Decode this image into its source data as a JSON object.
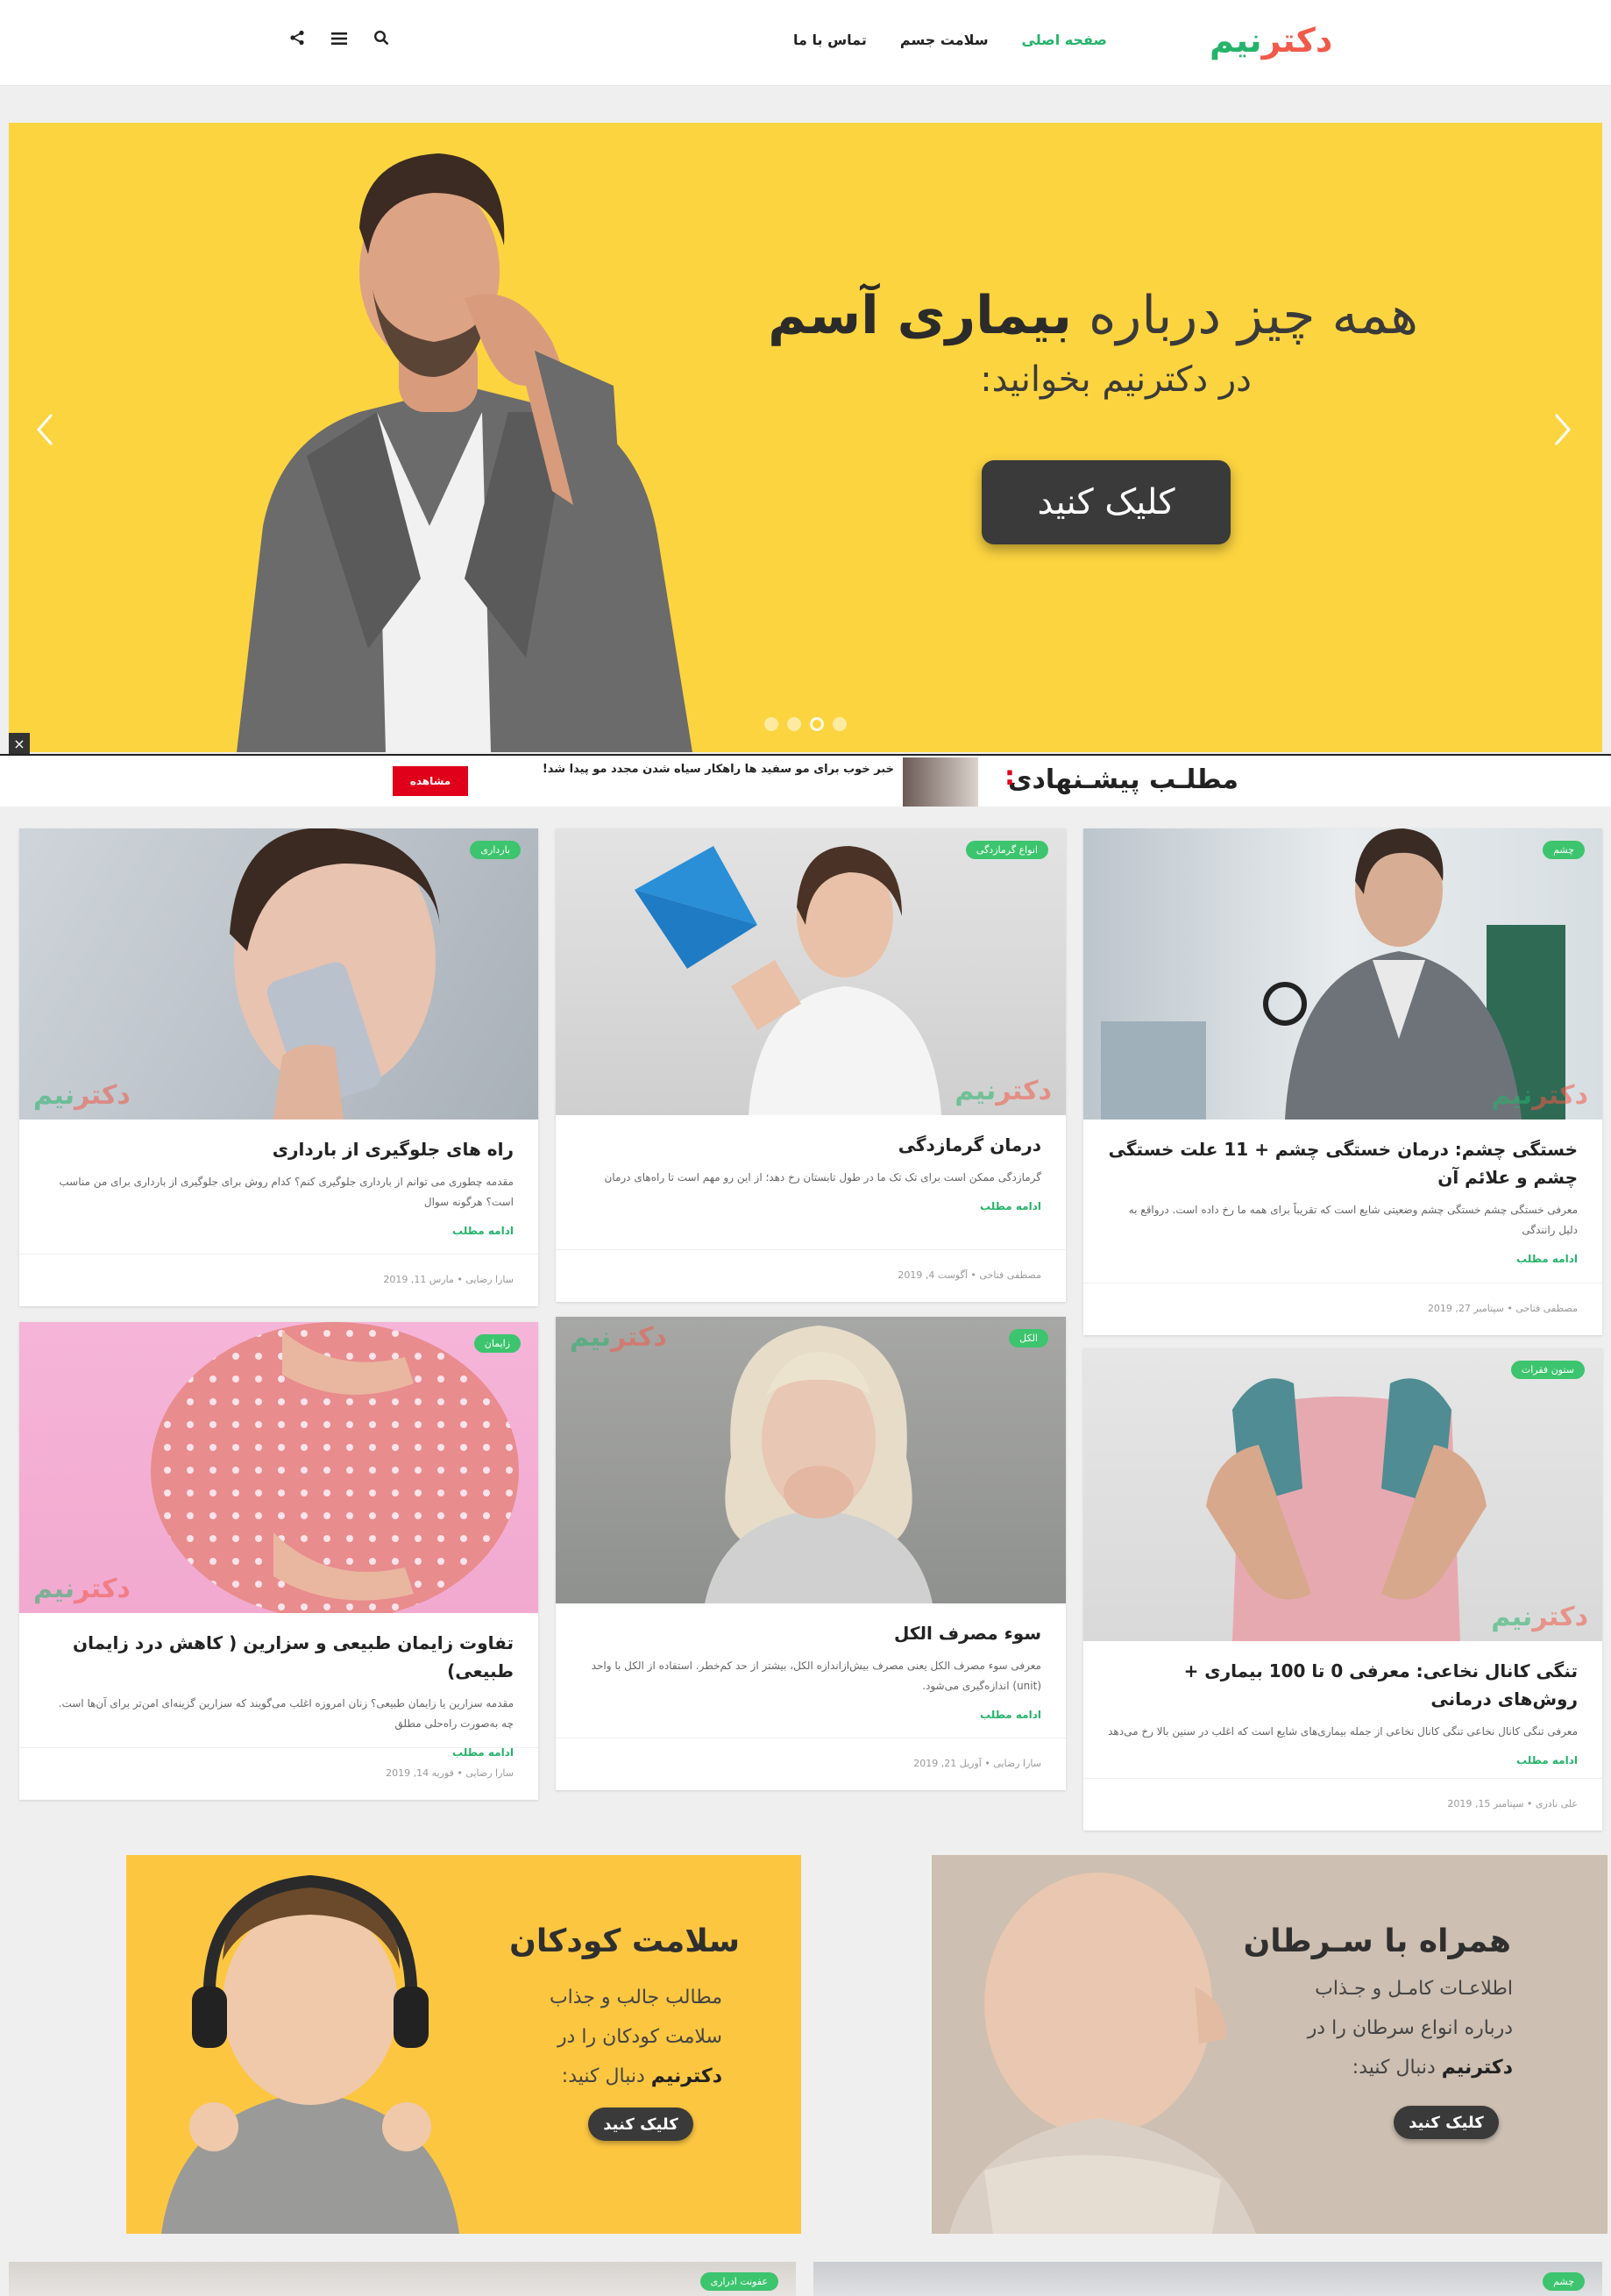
{
  "header": {
    "logo_part1": "دکتر",
    "logo_part2": "نیم",
    "nav": [
      {
        "label": "صفحه اصلی",
        "active": true
      },
      {
        "label": "سلامت جسم",
        "active": false
      },
      {
        "label": "تماس با ما",
        "active": false
      }
    ]
  },
  "hero": {
    "title_plain": "همه چیز درباره ",
    "title_bold": "بیماری آسم",
    "subtitle": "در دکترنیم بخوانید:",
    "cta": "کلیک کنید",
    "active_slide": 3,
    "slide_count": 4
  },
  "suggest": {
    "title": "مطلـب پیشـنهادی",
    "headline": "خبر خوب برای مو سفید ها راهکار سیاه شدن مجدد مو پیدا شد!",
    "button": "مشاهده"
  },
  "cards": [
    {
      "tag": "بارداری",
      "title": "راه های جلوگیری از بارداری",
      "excerpt": "مقدمه چطوری می توانم از بارداری جلوگیری کنم؟ کدام روش برای جلوگیری از بارداری برای من مناسب است؟ هرگونه سوال",
      "more": "ادامه مطلب",
      "author": "سارا رضایی",
      "date": "مارس 11, 2019"
    },
    {
      "tag": "انواع گرمازدگی",
      "title": "درمان گرمازدگی",
      "excerpt": "گرمازدگی ممکن است برای تک تک ما در طول تابستان رخ دهد؛ از این رو مهم است تا راه‌های درمان",
      "more": "ادامه مطلب",
      "author": "مصطفی فتاحی",
      "date": "آگوست 4, 2019"
    },
    {
      "tag": "چشم",
      "title": "خستگی چشم: درمان خستگی چشم + 11 علت خستگی چشم و علائم آن",
      "excerpt": "معرفی خستگی چشم خستگی چشم وضعیتی شایع است که تقریباً برای همه ما رخ داده است. درواقع به دلیل رانندگی",
      "more": "ادامه مطلب",
      "author": "مصطفی فتاحی",
      "date": "سپتامبر 27, 2019"
    },
    {
      "tag": "زایمان",
      "title": "تفاوت زایمان طبیعی و سزارین ( کاهش درد زایمان طبیعی)",
      "excerpt": "مقدمه سزارین یا زایمان طبیعی؟ زنان امروزه اغلب می‌گویند که سزارین گزینه‌ای امن‌تر برای آن‌ها است. چه به‌صورت راه‌حلی مطلق",
      "more": "ادامه مطلب",
      "author": "سارا رضایی",
      "date": "فوریه 14, 2019"
    },
    {
      "tag": "الکل",
      "title": "سوء مصرف الکل",
      "excerpt": "معرفی سوء مصرف الکل یعنی مصرف بیش‌از‌اندازه الکل، بیشتر از حد کم‌خطر. استفاده از الکل با واحد (unit) اندازه‌گیری می‌شود.",
      "more": "ادامه مطلب",
      "author": "سارا رضایی",
      "date": "آوریل 21, 2019"
    },
    {
      "tag": "ستون فقرات",
      "title": "تنگی کانال نخاعی: معرفی 0 تا 100 بیماری + روش‌های درمانی",
      "excerpt": "معرفی تنگی کانال نخاعی تنگی کانال نخاعی از جمله بیماری‌های شایع است که اغلب در سنین بالا رخ می‌دهد",
      "more": "ادامه مطلب",
      "author": "علی نادری",
      "date": "سپتامبر 15, 2019"
    }
  ],
  "promos": [
    {
      "title": "سلامت کودکان",
      "line1": "مطالب جالب و جذاب",
      "line2": "سلامت کودکان را در",
      "line3_bold": "دکترنیم",
      "line3_rest": " دنبال کنید:",
      "button": "کلیک کنید"
    },
    {
      "title": "همراه با سـرطان",
      "line1": "اطلاعـات کامـل و جـذاب",
      "line2": "درباره انواع سرطان را در",
      "line3_bold": "دکترنیم",
      "line3_rest": " دنبال کنید:",
      "button": "کلیک کنید"
    }
  ],
  "bottom_tags": [
    "عفونت ادراری",
    "چشم"
  ]
}
